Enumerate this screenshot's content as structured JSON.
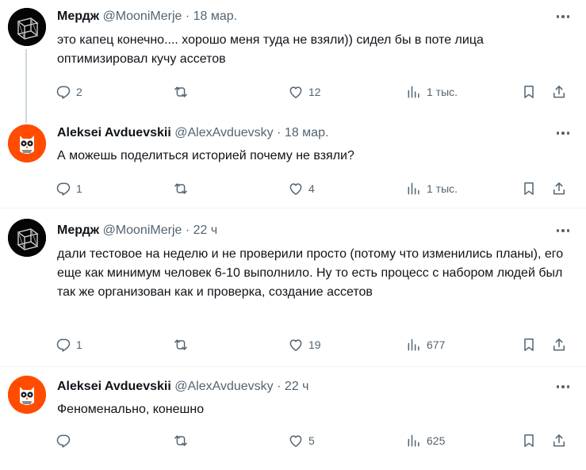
{
  "colors": {
    "accent": "#1d9bf0",
    "text": "#0f1419",
    "muted": "#536471",
    "divider": "#eff3f4",
    "aleksei_avatar_bg": "#ff4c00"
  },
  "icons": {
    "reply": "reply-icon",
    "retweet": "retweet-icon",
    "like": "heart-icon",
    "views": "views-chart-icon",
    "bookmark": "bookmark-icon",
    "share": "share-icon",
    "more": "more-icon"
  },
  "tweets": [
    {
      "name": "Мердж",
      "handle": "@MooniMerje",
      "dot": "·",
      "time": "18 мар.",
      "text": "это капец конечно.... хорошо меня туда не взяли)) сидел бы в поте лица оптимизировал кучу ассетов",
      "replies": "2",
      "retweets": "",
      "likes": "12",
      "views": "1 тыс."
    },
    {
      "name": "Aleksei Avduevskii",
      "handle": "@AlexAvduevsky",
      "dot": "·",
      "time": "18 мар.",
      "text": "А можешь поделиться историей почему не взяли?",
      "replies": "1",
      "retweets": "",
      "likes": "4",
      "views": "1 тыс."
    },
    {
      "name": "Мердж",
      "handle": "@MooniMerje",
      "dot": "·",
      "time": "22 ч",
      "text": "дали тестовое на неделю и не проверили просто (потому что изменились планы), его еще как минимум человек 6-10 выполнило. Ну то есть процесс с набором людей был так же организован как и проверка, создание ассетов",
      "replies": "1",
      "retweets": "",
      "likes": "19",
      "views": "677"
    },
    {
      "name": "Aleksei Avduevskii",
      "handle": "@AlexAvduevsky",
      "dot": "·",
      "time": "22 ч",
      "text": "Феноменально, конешно",
      "replies": "",
      "retweets": "",
      "likes": "5",
      "views": "625"
    }
  ]
}
